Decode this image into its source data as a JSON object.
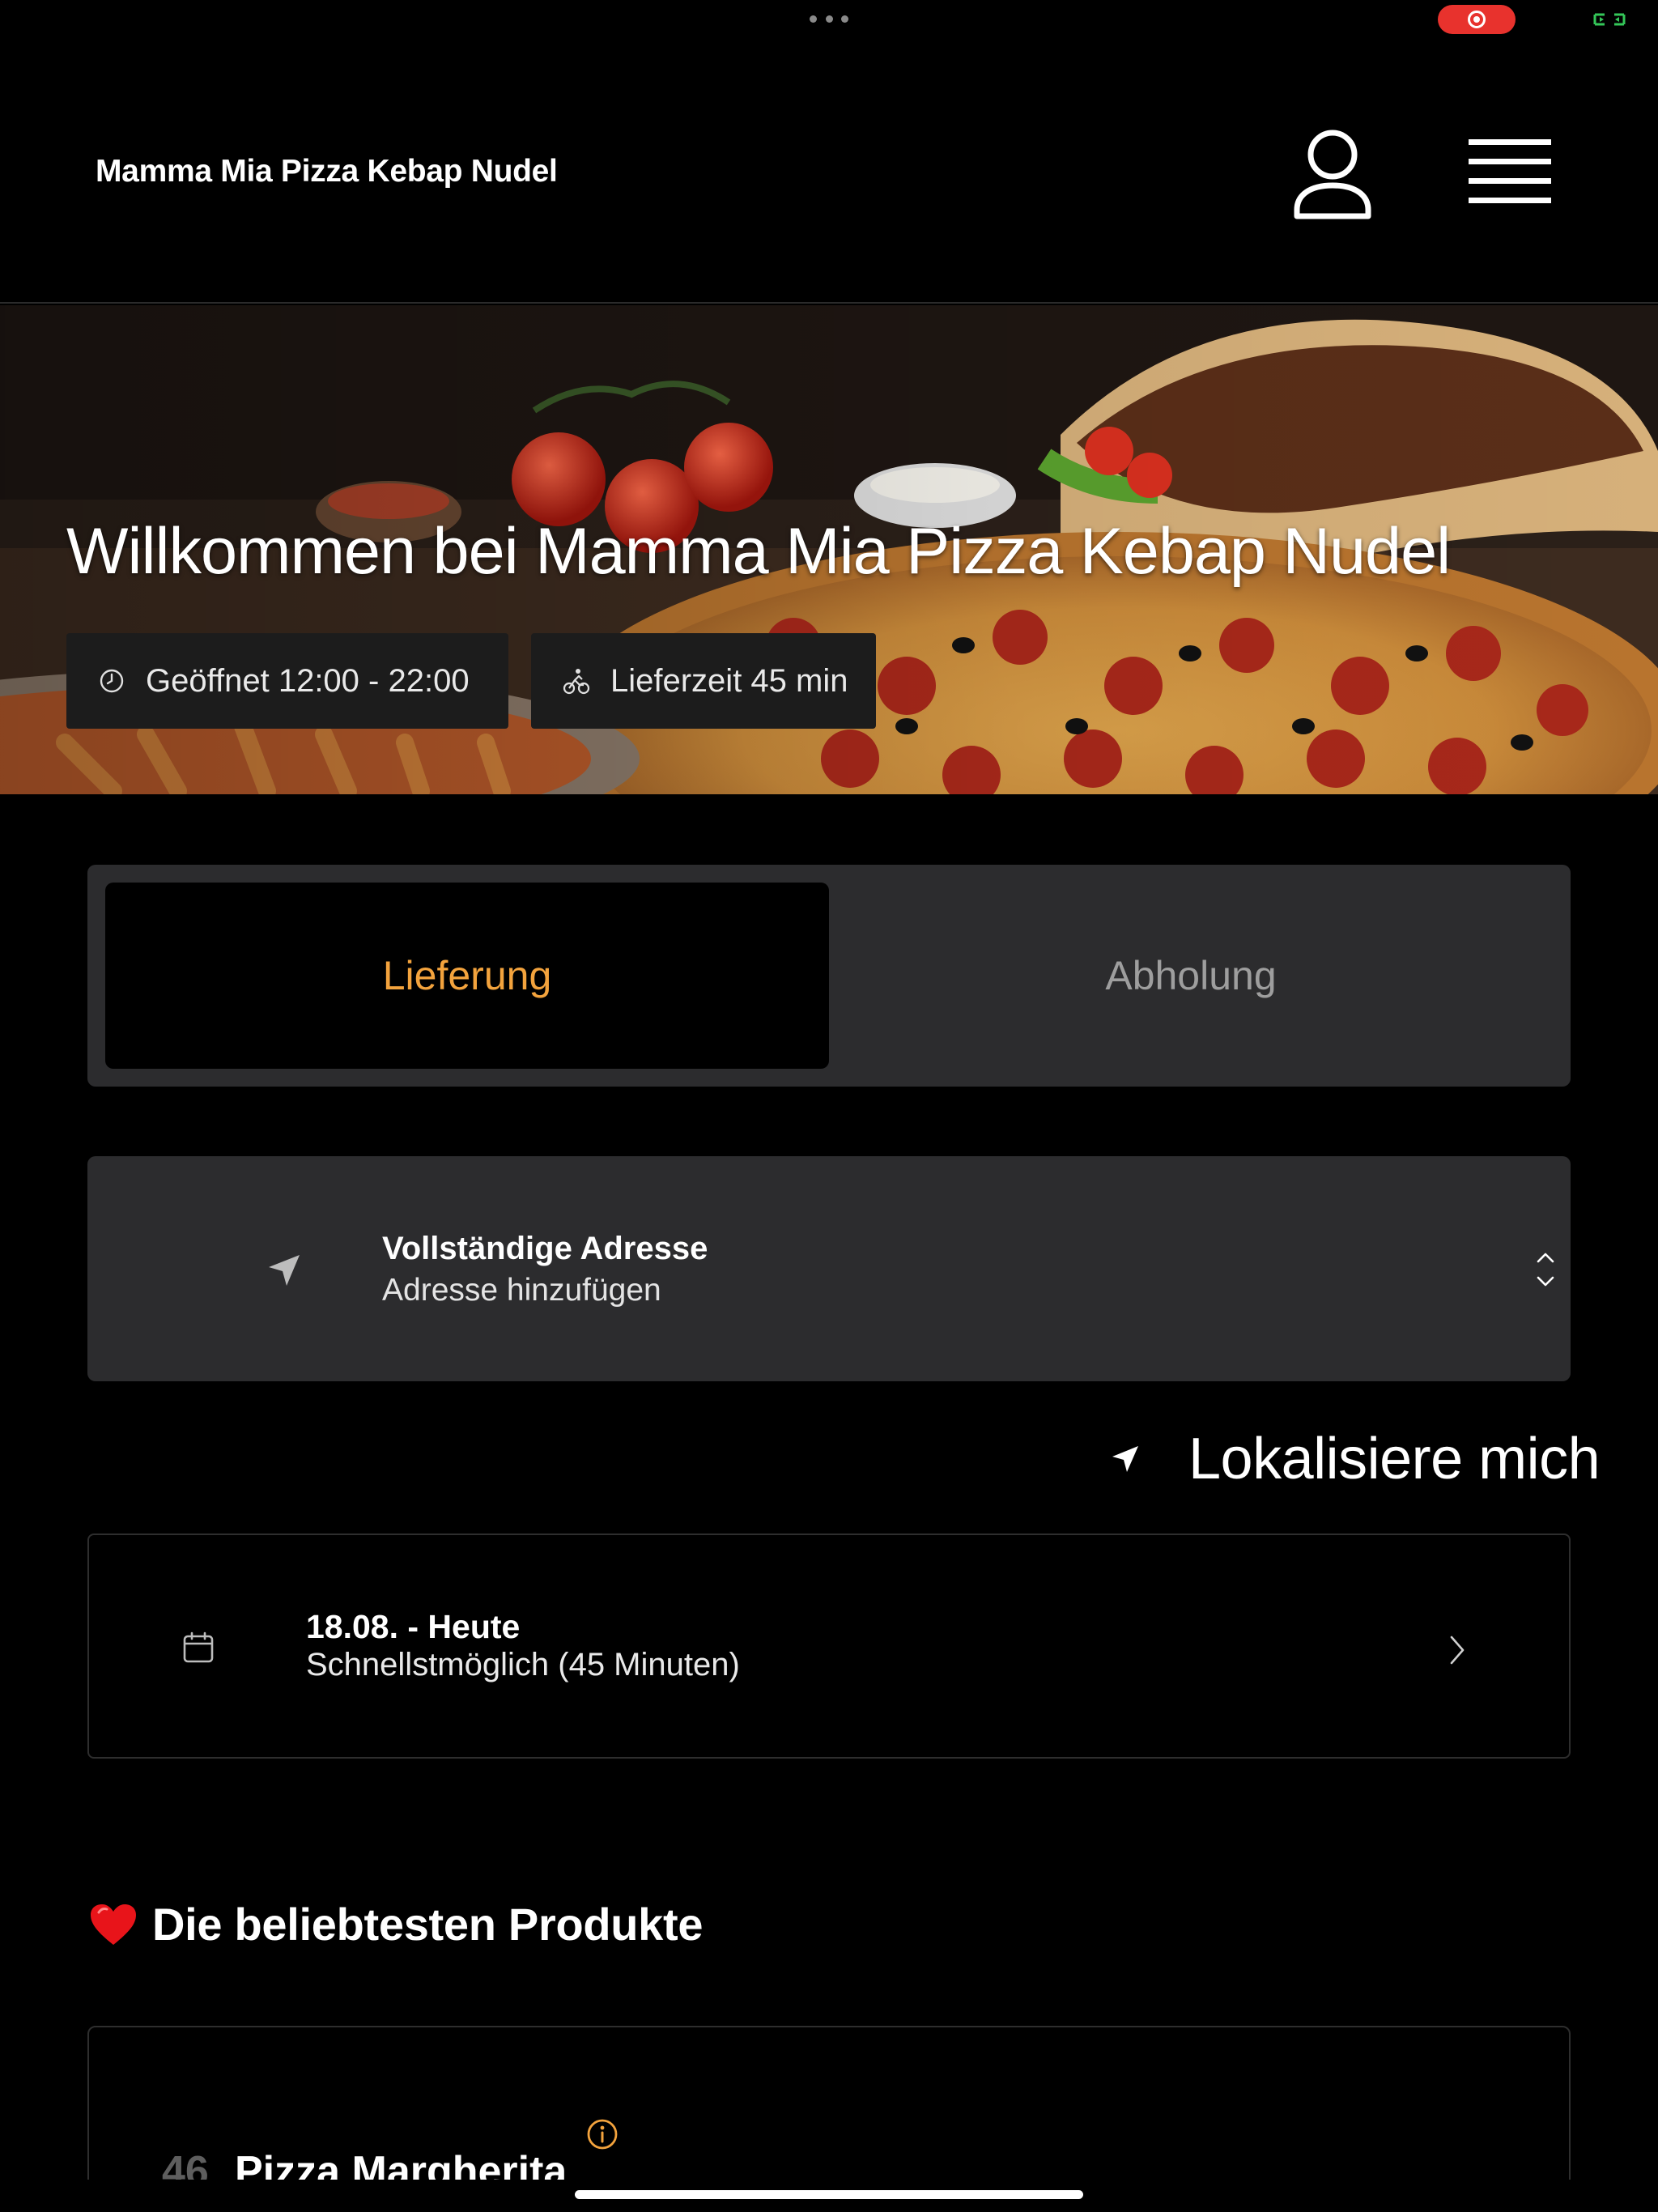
{
  "header": {
    "brand": "Mamma Mia Pizza Kebap Nudel"
  },
  "hero": {
    "title": "Willkommen bei Mamma Mia Pizza Kebap Nudel",
    "open_hours": "Geöffnet 12:00 - 22:00",
    "delivery_time": "Lieferzeit 45 min"
  },
  "order_mode": {
    "tabs": [
      {
        "label": "Lieferung",
        "active": true
      },
      {
        "label": "Abholung",
        "active": false
      }
    ]
  },
  "address": {
    "title": "Vollständige Adresse",
    "subtitle": "Adresse hinzufügen"
  },
  "locate": {
    "label": "Lokalisiere mich"
  },
  "schedule": {
    "title": "18.08. - Heute",
    "subtitle": "Schnellstmöglich (45 Minuten)"
  },
  "popular": {
    "heading": "Die beliebtesten Produkte",
    "products": [
      {
        "number": "46",
        "name": "Pizza Margherita"
      }
    ]
  },
  "colors": {
    "accent": "#f3a33d",
    "background": "#000000",
    "card": "#2c2c2e",
    "record": "#e8322d"
  }
}
